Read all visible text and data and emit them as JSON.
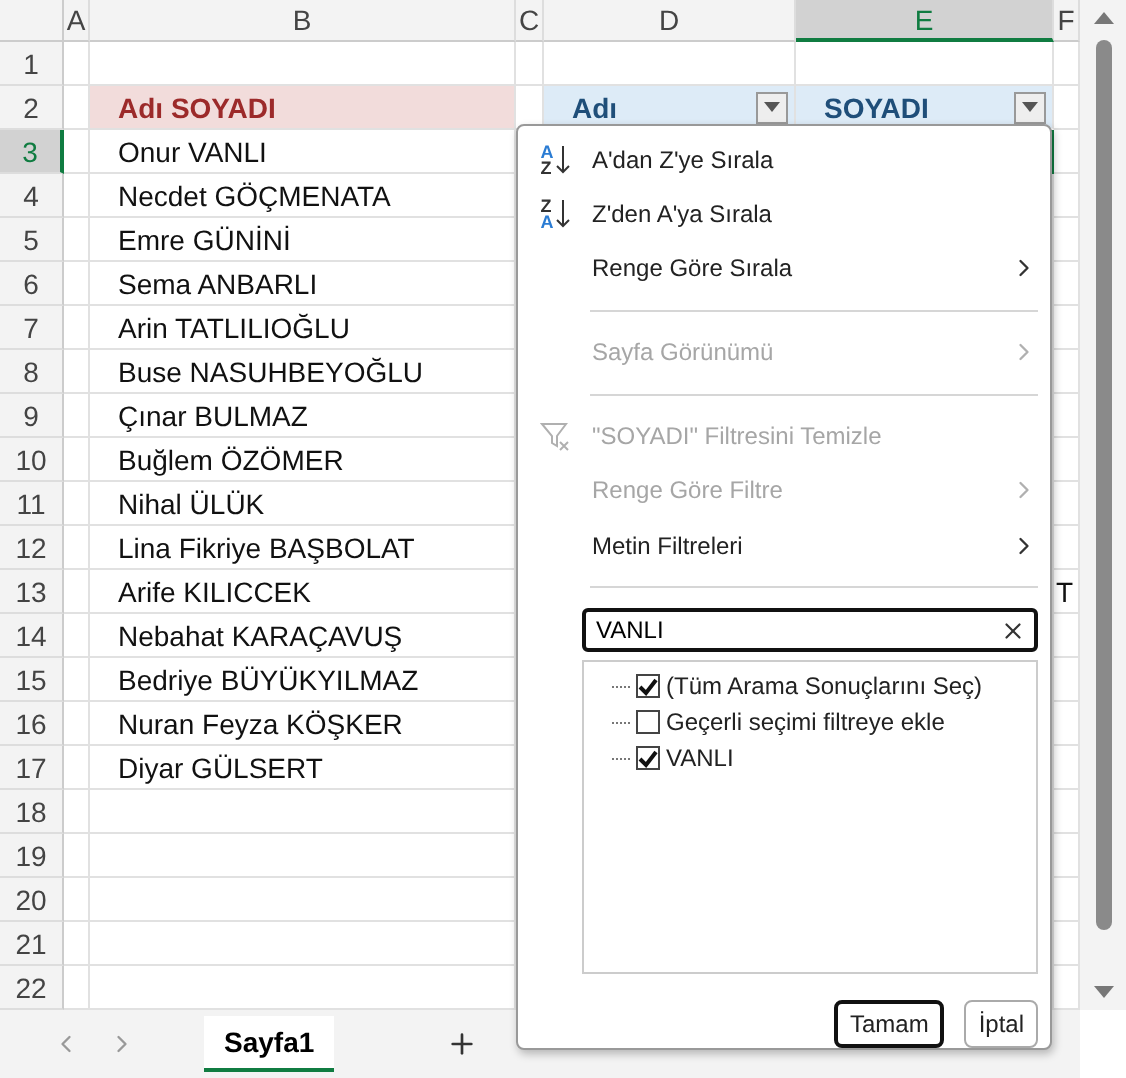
{
  "columns": [
    {
      "label": "A",
      "selected": false
    },
    {
      "label": "B",
      "selected": false
    },
    {
      "label": "C",
      "selected": false
    },
    {
      "label": "D",
      "selected": false
    },
    {
      "label": "E",
      "selected": true
    },
    {
      "label": "F",
      "selected": false
    }
  ],
  "rows": [
    {
      "number": "1",
      "kind": "plain",
      "selected": false
    },
    {
      "number": "2",
      "kind": "header",
      "selected": false,
      "b": "Adı SOYADI",
      "d": "Adı",
      "e": "SOYADI"
    },
    {
      "number": "3",
      "kind": "plain",
      "selected": true,
      "b": "Onur VANLI"
    },
    {
      "number": "4",
      "kind": "plain",
      "selected": false,
      "b": "Necdet GÖÇMENATA"
    },
    {
      "number": "5",
      "kind": "plain",
      "selected": false,
      "b": "Emre GÜNİNİ"
    },
    {
      "number": "6",
      "kind": "plain",
      "selected": false,
      "b": "Sema ANBARLI"
    },
    {
      "number": "7",
      "kind": "plain",
      "selected": false,
      "b": "Arin TATLILIOĞLU"
    },
    {
      "number": "8",
      "kind": "plain",
      "selected": false,
      "b": "Buse NASUHBEYOĞLU"
    },
    {
      "number": "9",
      "kind": "plain",
      "selected": false,
      "b": "Çınar BULMAZ"
    },
    {
      "number": "10",
      "kind": "plain",
      "selected": false,
      "b": "Buğlem ÖZÖMER"
    },
    {
      "number": "11",
      "kind": "plain",
      "selected": false,
      "b": "Nihal ÜLÜK"
    },
    {
      "number": "12",
      "kind": "plain",
      "selected": false,
      "b": "Lina Fikriye BAŞBOLAT"
    },
    {
      "number": "13",
      "kind": "plain",
      "selected": false,
      "b": "Arife KILICCEK",
      "f": "T"
    },
    {
      "number": "14",
      "kind": "plain",
      "selected": false,
      "b": "Nebahat KARAÇAVUŞ"
    },
    {
      "number": "15",
      "kind": "plain",
      "selected": false,
      "b": "Bedriye BÜYÜKYILMAZ"
    },
    {
      "number": "16",
      "kind": "plain",
      "selected": false,
      "b": "Nuran Feyza KÖŞKER"
    },
    {
      "number": "17",
      "kind": "plain",
      "selected": false,
      "b": "Diyar GÜLSERT"
    },
    {
      "number": "18",
      "kind": "plain",
      "selected": false
    },
    {
      "number": "19",
      "kind": "plain",
      "selected": false
    },
    {
      "number": "20",
      "kind": "plain",
      "selected": false
    },
    {
      "number": "21",
      "kind": "plain",
      "selected": false
    },
    {
      "number": "22",
      "kind": "plain",
      "selected": false
    }
  ],
  "filter_menu": {
    "items": [
      {
        "kind": "sort",
        "label": "A'dan Z'ye Sırala",
        "icon_text": [
          "A",
          "Z"
        ],
        "disabled": false
      },
      {
        "kind": "sort",
        "label": "Z'den A'ya Sırala",
        "icon_text": [
          "Z",
          "A"
        ],
        "disabled": false
      },
      {
        "kind": "submenu",
        "label": "Renge Göre Sırala",
        "disabled": false
      },
      {
        "kind": "separator"
      },
      {
        "kind": "submenu",
        "label": "Sayfa Görünümü",
        "disabled": true
      },
      {
        "kind": "separator"
      },
      {
        "kind": "clear",
        "label": "\"SOYADI\" Filtresini Temizle",
        "disabled": true
      },
      {
        "kind": "submenu",
        "label": "Renge Göre Filtre",
        "disabled": true
      },
      {
        "kind": "submenu",
        "label": "Metin Filtreleri",
        "disabled": false
      },
      {
        "kind": "separator"
      }
    ],
    "search": {
      "value": "VANLI"
    },
    "checklist": [
      {
        "label": "(Tüm Arama Sonuçlarını Seç)",
        "checked": true
      },
      {
        "label": "Geçerli seçimi filtreye ekle",
        "checked": false
      },
      {
        "label": "VANLI",
        "checked": true
      }
    ],
    "buttons": [
      {
        "label": "Tamam",
        "default": true
      },
      {
        "label": "İptal",
        "default": false
      }
    ]
  },
  "sheet_tabs": [
    {
      "label": "Sayfa1",
      "selected": true
    }
  ]
}
